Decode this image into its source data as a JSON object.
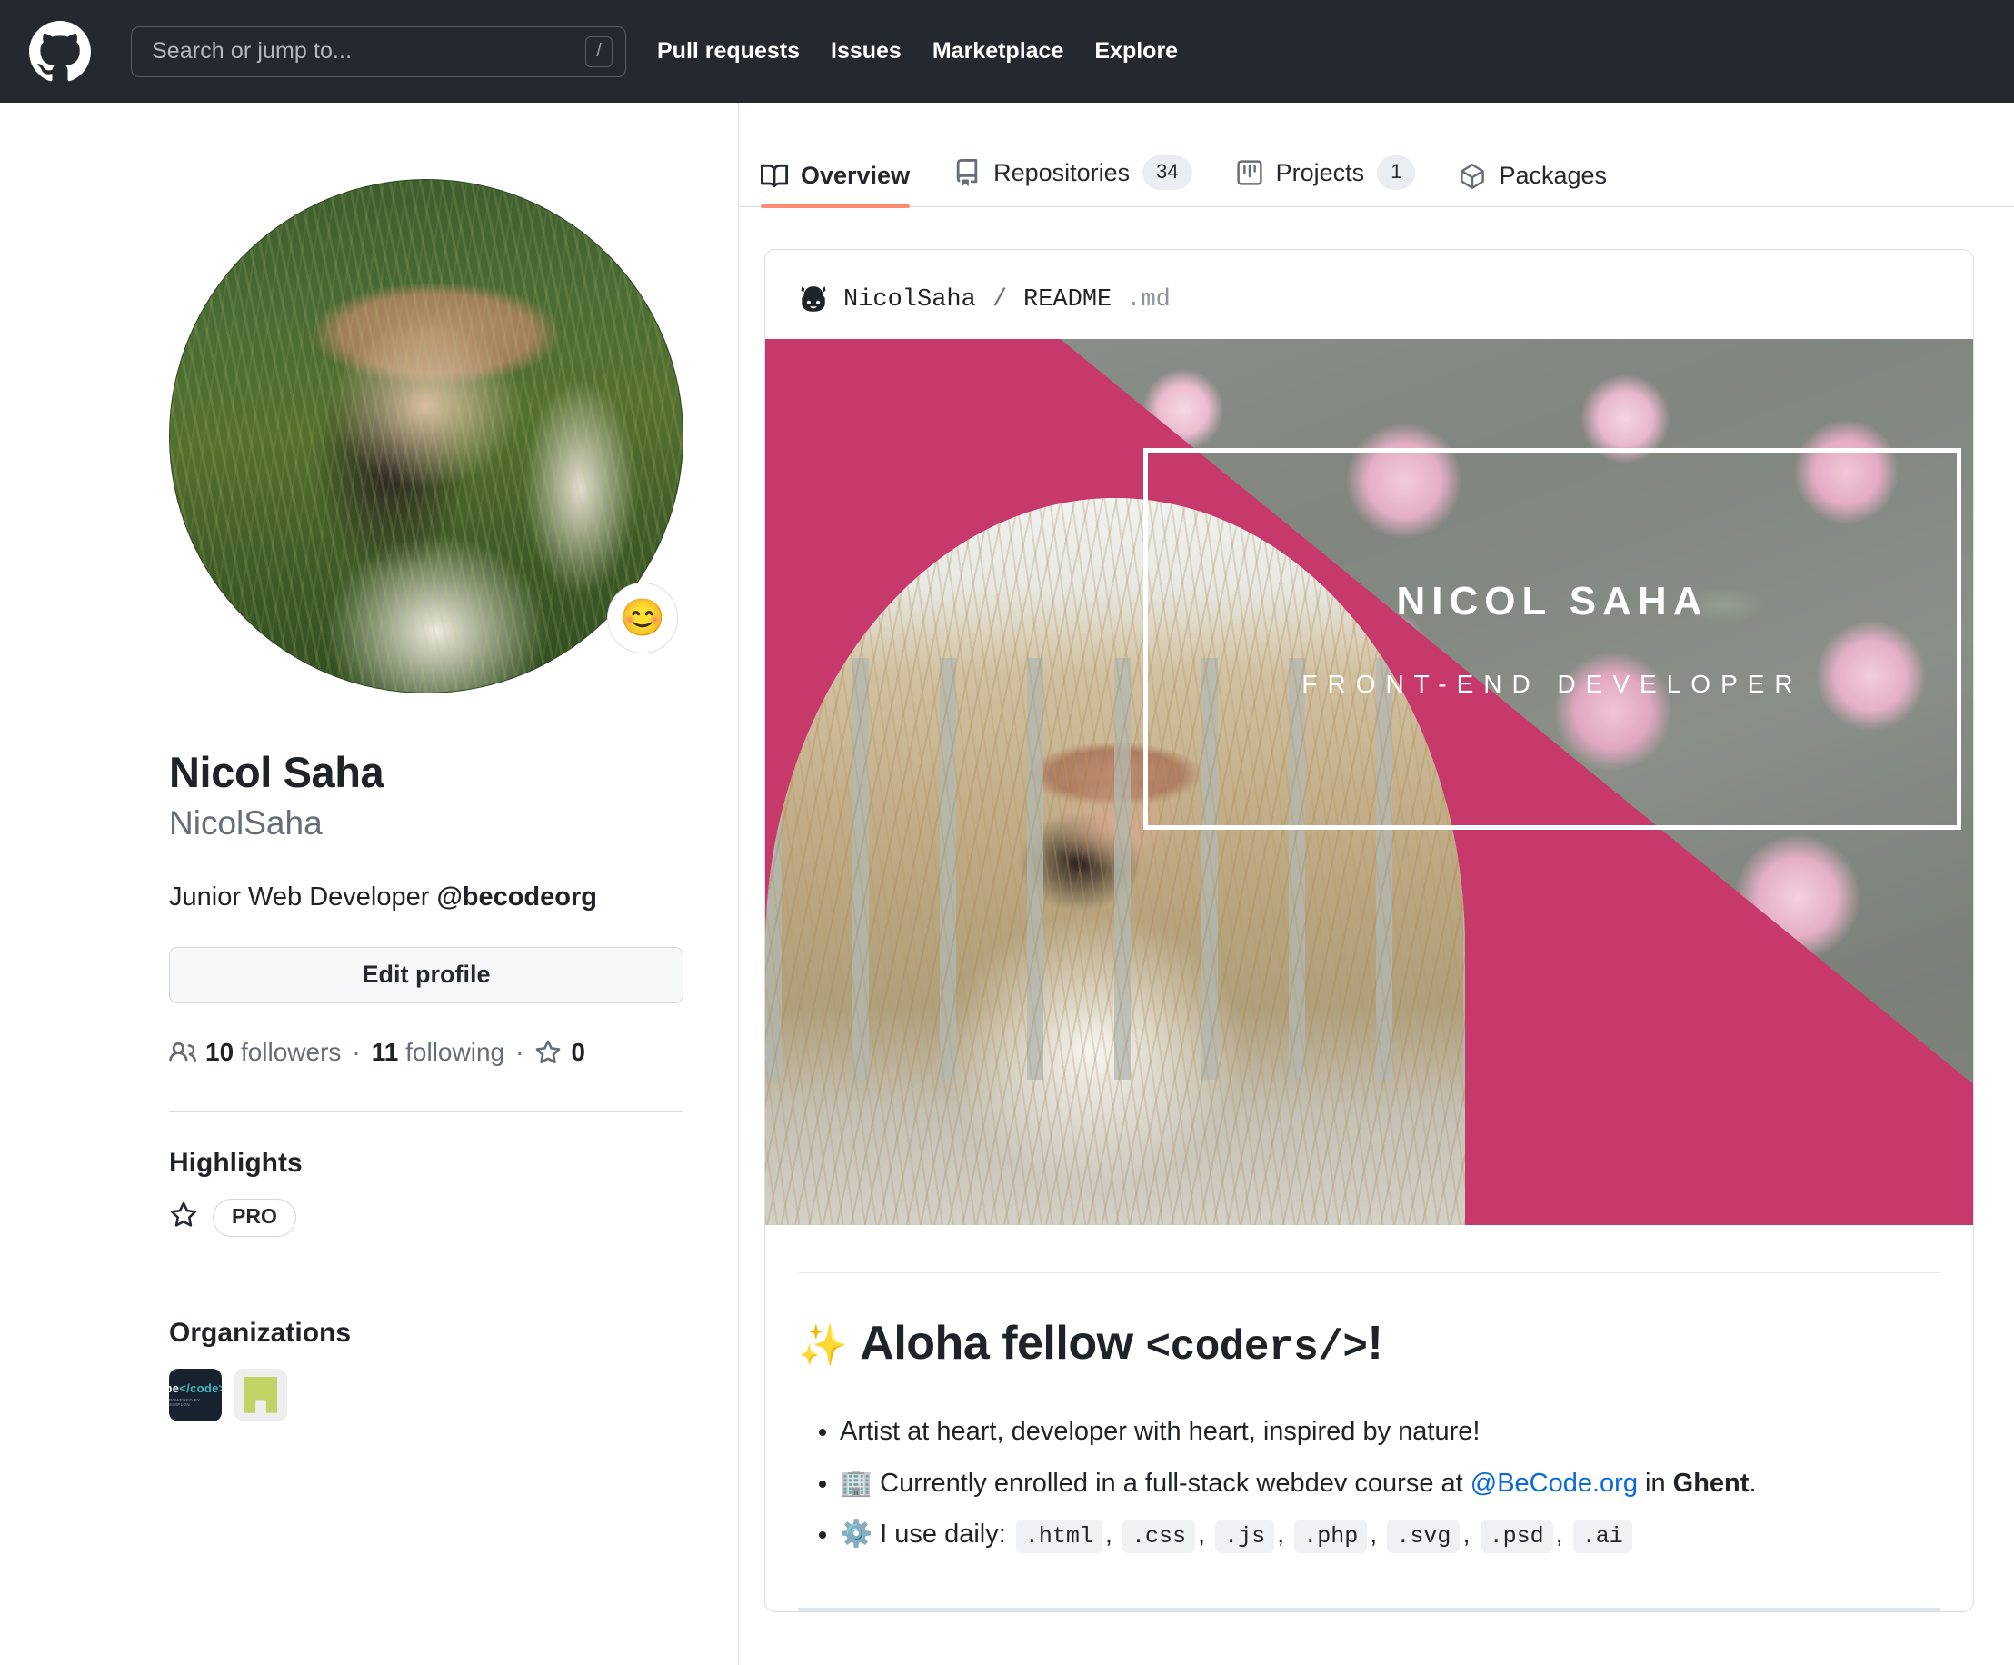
{
  "header": {
    "logo_icon": "github-mark-icon",
    "search": {
      "placeholder": "Search or jump to...",
      "kbd_hint": "/"
    },
    "nav": [
      {
        "label": "Pull requests"
      },
      {
        "label": "Issues"
      },
      {
        "label": "Marketplace"
      },
      {
        "label": "Explore"
      }
    ]
  },
  "profile": {
    "avatar_alt": "profile-photo",
    "status_emoji": "😊",
    "full_name": "Nicol Saha",
    "username": "NicolSaha",
    "bio_prefix": "Junior Web Developer ",
    "bio_org": "@becodeorg",
    "edit_button": "Edit profile",
    "stats": {
      "followers_count": "10",
      "followers_label": "followers",
      "following_count": "11",
      "following_label": "following",
      "stars_count": "0",
      "separator": "·"
    },
    "highlights": {
      "title": "Highlights",
      "pro_badge": "PRO",
      "star_icon": "star-icon"
    },
    "organizations": {
      "title": "Organizations",
      "items": [
        {
          "name": "becode",
          "logo_text": "be",
          "logo_text_accent": "</code>",
          "logo_sub": "POWERED BY SIMPLON"
        },
        {
          "name": "green-org",
          "logo_text": "",
          "logo_text_accent": "",
          "logo_sub": ""
        }
      ]
    }
  },
  "tabs": [
    {
      "label": "Overview",
      "icon": "book-icon",
      "count": null,
      "active": true
    },
    {
      "label": "Repositories",
      "icon": "repo-icon",
      "count": "34",
      "active": false
    },
    {
      "label": "Projects",
      "icon": "project-icon",
      "count": "1",
      "active": false
    },
    {
      "label": "Packages",
      "icon": "package-icon",
      "count": null,
      "active": false
    }
  ],
  "readme": {
    "owner": "NicolSaha",
    "slash": "/",
    "file_name": "README",
    "file_ext": ".md",
    "octocat_icon": "octocat-icon",
    "banner": {
      "name": "NICOL SAHA",
      "role": "FRONT-END DEVELOPER",
      "accent_color": "#c8396b"
    },
    "heading": {
      "emoji": "✨",
      "text_before": "Aloha fellow ",
      "code_text": "<coders/>",
      "text_after": "!"
    },
    "bullets": [
      {
        "emoji": "",
        "text": "Artist at heart, developer with heart, inspired by nature!"
      },
      {
        "emoji": "🏢",
        "text_before": " Currently enrolled in a full-stack webdev course at ",
        "link": "@BeCode.org",
        "text_middle": " in ",
        "bold": "Ghent",
        "text_after": "."
      },
      {
        "emoji": "⚙️",
        "text_before": " I use daily: ",
        "chips": [
          ".html",
          ".css",
          ".js",
          ".php",
          ".svg",
          ".psd",
          ".ai"
        ],
        "chip_separator": ","
      }
    ]
  },
  "colors": {
    "header_bg": "#24292f",
    "accent_tab": "#fd8c73",
    "link": "#0969da",
    "border": "#d8dee4",
    "muted_text": "#656d76"
  }
}
